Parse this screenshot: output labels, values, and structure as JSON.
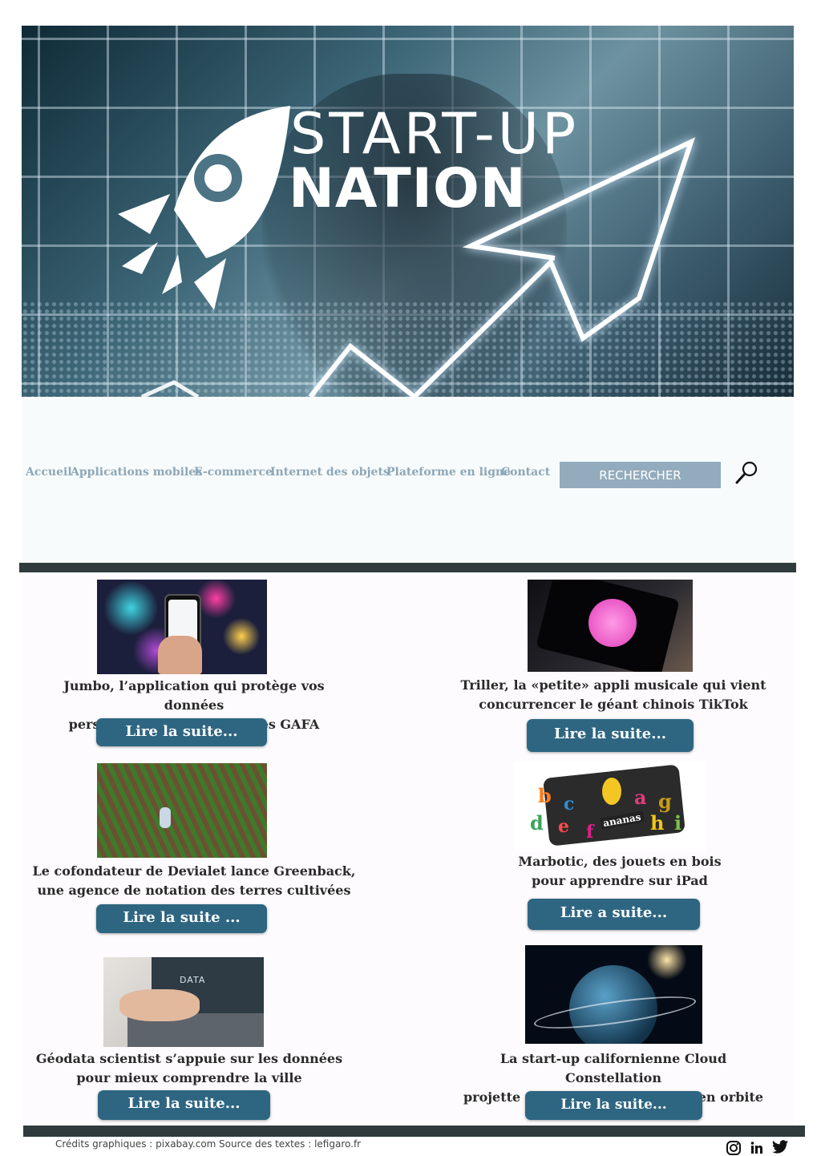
{
  "hero": {
    "logo_line1": "START-UP",
    "logo_line2": "NATION"
  },
  "nav": {
    "items": [
      {
        "label": "Accueil"
      },
      {
        "label": "Applications mobiles"
      },
      {
        "label": "E-commerce"
      },
      {
        "label": "Internet des objets"
      },
      {
        "label": "Plateforme en ligne"
      },
      {
        "label": "Contact"
      }
    ],
    "search_placeholder": "RECHERCHER",
    "search_icon": "magnifier-icon"
  },
  "articles": [
    {
      "title_line1": "Jumbo, l’application qui protège vos données",
      "title_line2": "personnelles de l’appétit des GAFA",
      "more": "Lire la suite..."
    },
    {
      "title_line1": "Triller, la «petite» appli musicale qui vient",
      "title_line2": "concurrencer le géant chinois TikTok",
      "more": "Lire la suite..."
    },
    {
      "title_line1": "Le cofondateur de Devialet lance Greenback,",
      "title_line2": "une agence de notation des terres cultivées",
      "more": "Lire la suite ..."
    },
    {
      "title_line1": "Marbotic, des jouets en bois",
      "title_line2": "pour apprendre sur iPad",
      "more": "Lire a suite..."
    },
    {
      "title_line1": "Géodata scientist s’appuie sur les données",
      "title_line2": "pour mieux comprendre la ville",
      "more": "Lire la suite..."
    },
    {
      "title_line1": "La start-up californienne Cloud Constellation",
      "title_line2": "projette de stocker nos données en orbite",
      "more": "Lire la suite..."
    }
  ],
  "thumb_text": {
    "data_label": "DATA",
    "toy_word": "ananas",
    "toy_letters": [
      "b",
      "c",
      "a",
      "g",
      "d",
      "e",
      "h",
      "i",
      "f"
    ]
  },
  "footer": {
    "credits": "Crédits graphiques : pixabay.com",
    "source": "Source des textes : lefigaro.fr",
    "social": [
      "instagram-icon",
      "linkedin-icon",
      "twitter-icon"
    ]
  },
  "colors": {
    "nav_text": "#8ca7b8",
    "search_bg": "#93acbd",
    "button_bg": "#2e6682",
    "divider": "#2f3b3d"
  }
}
